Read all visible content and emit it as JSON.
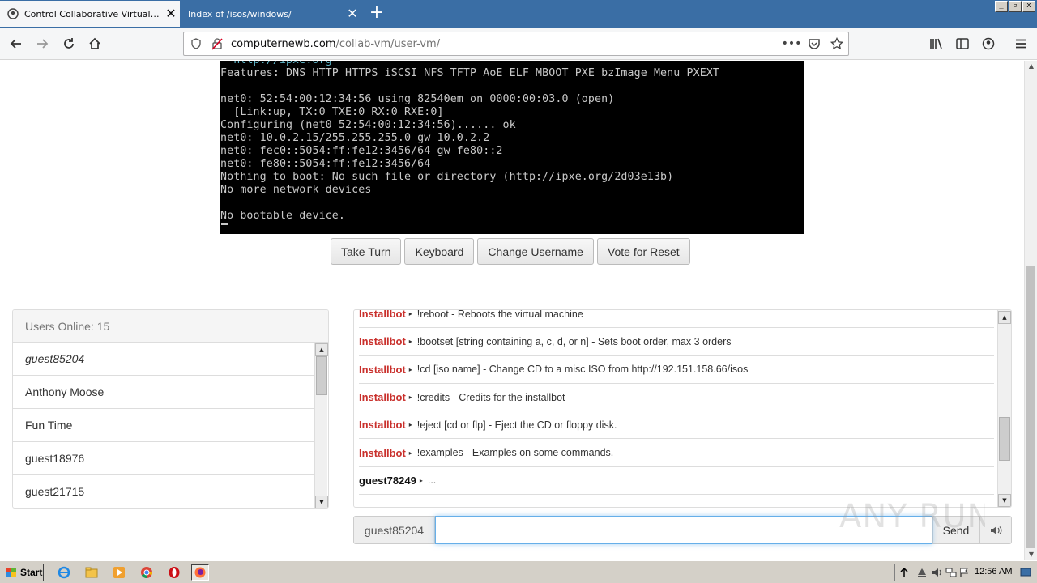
{
  "browser": {
    "tabs": [
      {
        "title": "Control Collaborative Virtual Machi",
        "active": true
      },
      {
        "title": "Index of /isos/windows/",
        "active": false
      }
    ],
    "new_tab_symbol": "+",
    "url": {
      "host": "computernewb.com",
      "path": "/collab-vm/user-vm/"
    },
    "url_more": "•••",
    "window_controls": [
      "_",
      "▫",
      "x"
    ]
  },
  "vm_console": {
    "lines": [
      {
        "text": "  http://ipxe.org",
        "color": "cyan"
      },
      {
        "text": "Features: DNS HTTP HTTPS iSCSI NFS TFTP AoE ELF MBOOT PXE bzImage Menu PXEXT",
        "color": "white"
      },
      {
        "text": "",
        "color": "white"
      },
      {
        "text": "net0: 52:54:00:12:34:56 using 82540em on 0000:00:03.0 (open)",
        "color": "white"
      },
      {
        "text": "  [Link:up, TX:0 TXE:0 RX:0 RXE:0]",
        "color": "white"
      },
      {
        "text": "Configuring (net0 52:54:00:12:34:56)...... ok",
        "color": "white"
      },
      {
        "text": "net0: 10.0.2.15/255.255.255.0 gw 10.0.2.2",
        "color": "white"
      },
      {
        "text": "net0: fec0::5054:ff:fe12:3456/64 gw fe80::2",
        "color": "white"
      },
      {
        "text": "net0: fe80::5054:ff:fe12:3456/64",
        "color": "white"
      },
      {
        "text": "Nothing to boot: No such file or directory (http://ipxe.org/2d03e13b)",
        "color": "white"
      },
      {
        "text": "No more network devices",
        "color": "white"
      },
      {
        "text": "",
        "color": "white"
      },
      {
        "text": "No bootable device.",
        "color": "white"
      }
    ]
  },
  "vm_buttons": {
    "take_turn": "Take Turn",
    "keyboard": "Keyboard",
    "change_username": "Change Username",
    "vote_reset": "Vote for Reset"
  },
  "users": {
    "heading": "Users Online: 15",
    "list": [
      "guest85204",
      "Anthony Moose",
      "Fun Time",
      "guest18976",
      "guest21715"
    ]
  },
  "chat": {
    "messages": [
      {
        "user": "Installbot",
        "text": "!reboot - Reboots the virtual machine",
        "bot": true
      },
      {
        "user": "Installbot",
        "text": "!bootset [string containing a, c, d, or n] - Sets boot order, max 3 orders",
        "bot": true
      },
      {
        "user": "Installbot",
        "text": "!cd [iso name] - Change CD to a misc ISO from http://192.151.158.66/isos",
        "bot": true
      },
      {
        "user": "Installbot",
        "text": "!credits - Credits for the installbot",
        "bot": true
      },
      {
        "user": "Installbot",
        "text": "!eject [cd or flp] - Eject the CD or floppy disk.",
        "bot": true
      },
      {
        "user": "Installbot",
        "text": "!examples - Examples on some commands.",
        "bot": true
      },
      {
        "user": "guest78249",
        "text": "...",
        "bot": false
      }
    ],
    "separator": "▸",
    "username": "guest85204",
    "input_value": "",
    "send_label": "Send"
  },
  "watermark": "ANY RUN",
  "taskbar": {
    "start_label": "Start",
    "clock": "12:56 AM"
  },
  "colors": {
    "bot_name": "#c9302c",
    "titlebar": "#3a6ea5",
    "taskbar": "#d4d0c8"
  }
}
